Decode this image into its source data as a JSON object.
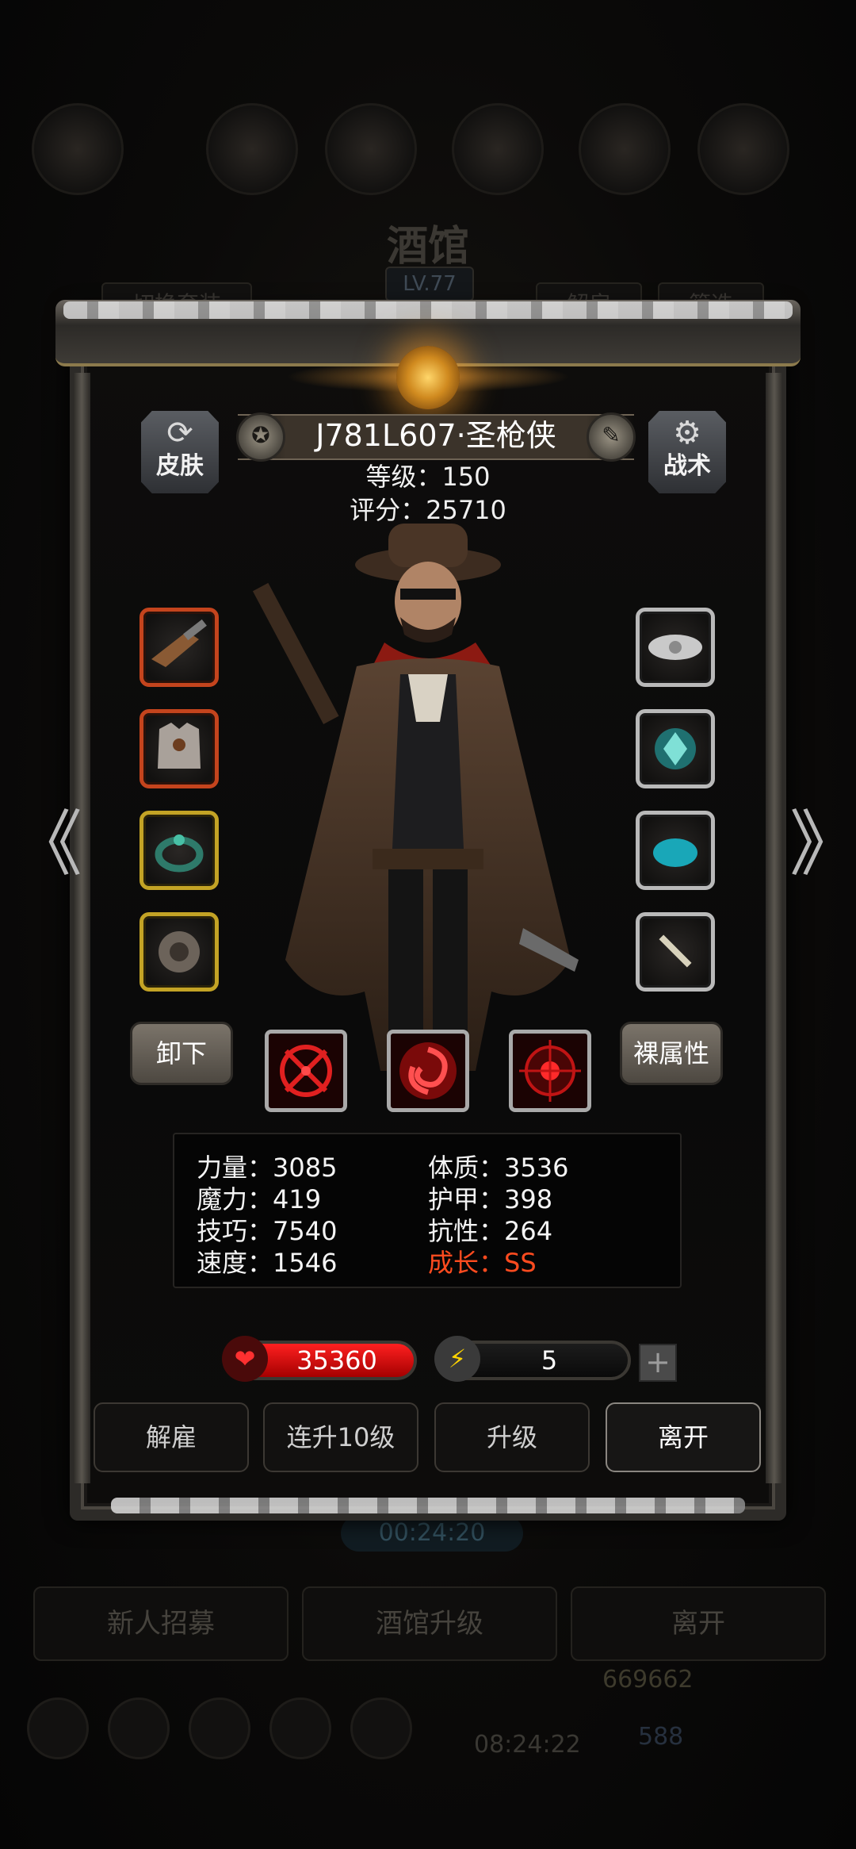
{
  "background": {
    "title": "酒馆",
    "level": "LV.77",
    "switch_outfit": "切换套装",
    "dismiss": "解雇",
    "filter": "筛选",
    "timer": "00:24:20",
    "recruit": "新人招募",
    "tavern_upgrade": "酒馆升级",
    "leave": "离开",
    "gold": "669662",
    "gems": "588",
    "bottom_timer": "08:24:22"
  },
  "hero": {
    "name": "J781L607·圣枪侠",
    "level_line": "等级：150",
    "score_line": "评分：25710"
  },
  "header": {
    "skin_label": "皮肤",
    "tactics_label": "战术",
    "skin_icon": "refresh-icon",
    "tactics_icon": "gear-icon"
  },
  "equipment": {
    "left": [
      {
        "name": "pistol",
        "rarity": "red"
      },
      {
        "name": "armor",
        "rarity": "red"
      },
      {
        "name": "ring",
        "rarity": "gold"
      },
      {
        "name": "gauntlet",
        "rarity": "gold"
      }
    ],
    "right": [
      {
        "name": "cloud-pearl",
        "rarity": "silver"
      },
      {
        "name": "crystal-orb",
        "rarity": "silver"
      },
      {
        "name": "blue-stone",
        "rarity": "silver"
      },
      {
        "name": "bone",
        "rarity": "silver"
      }
    ]
  },
  "actions_row": {
    "unequip": "卸下",
    "base_attributes": "裸属性"
  },
  "skills": [
    "crosshair-skill",
    "vortex-skill",
    "target-skill"
  ],
  "attributes": {
    "strength": "力量：3085",
    "constitution": "体质：3536",
    "magic": "魔力：419",
    "armor": "护甲：398",
    "skill": "技巧：7540",
    "resistance": "抗性：264",
    "speed": "速度：1546",
    "growth": "成长：SS"
  },
  "vitals": {
    "hp": "35360",
    "energy": "5",
    "plus": "+"
  },
  "buttons": {
    "dismiss": "解雇",
    "level_up_10": "连升10级",
    "level_up": "升级",
    "leave": "离开"
  },
  "nav": {
    "prev": "《",
    "next": "》"
  },
  "colors": {
    "growth": "#ff4b1f",
    "hp": "#e01010",
    "frame_red": "#c4441d",
    "frame_gold": "#c3a325",
    "frame_silver": "#b9b9b9"
  }
}
